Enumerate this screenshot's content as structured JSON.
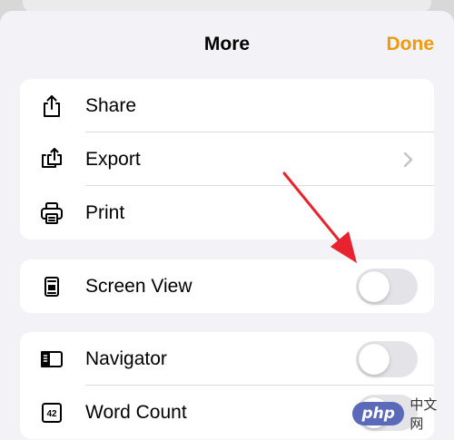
{
  "header": {
    "title": "More",
    "done_label": "Done"
  },
  "colors": {
    "accent": "#f09a0c",
    "arrow": "#e8232f",
    "toggle_off": "#e3e3e8",
    "background": "#f2f2f7"
  },
  "groups": [
    {
      "items": [
        {
          "label": "Share",
          "icon": "share-icon"
        },
        {
          "label": "Export",
          "icon": "export-icon",
          "accessory": "chevron-right-icon"
        },
        {
          "label": "Print",
          "icon": "printer-icon"
        }
      ]
    },
    {
      "items": [
        {
          "label": "Screen View",
          "icon": "screen-view-icon",
          "toggle": false
        }
      ]
    },
    {
      "items": [
        {
          "label": "Navigator",
          "icon": "sidebar-icon",
          "toggle": false
        },
        {
          "label": "Word Count",
          "icon": "word-count-icon",
          "icon_text": "42",
          "toggle": false
        }
      ]
    }
  ],
  "watermark": {
    "badge": "php",
    "text": "中文网"
  }
}
